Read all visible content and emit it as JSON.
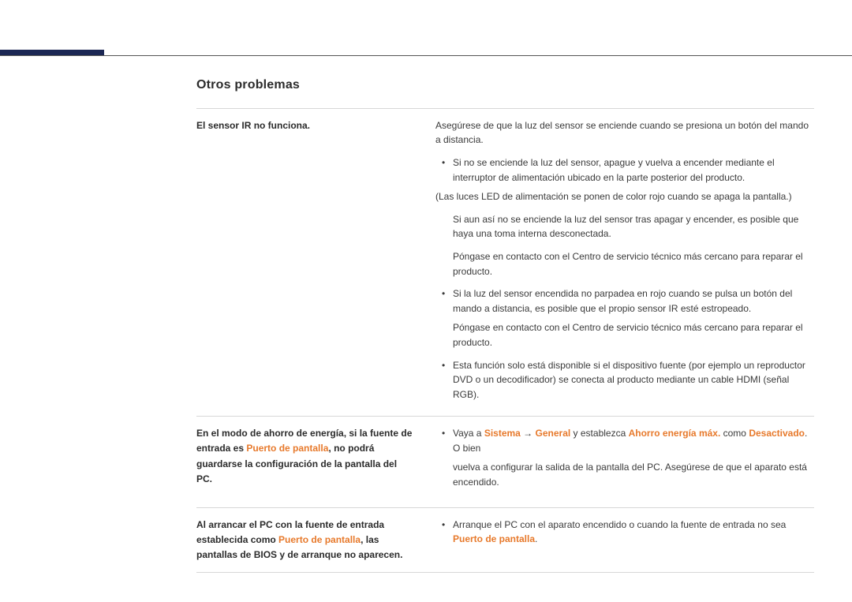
{
  "heading": "Otros problemas",
  "rows": [
    {
      "left_parts": [
        {
          "text": "El sensor IR no funciona.",
          "bold": true
        }
      ],
      "right_blocks": [
        {
          "type": "p",
          "parts": [
            {
              "text": "Asegúrese de que la luz del sensor se enciende cuando se presiona un botón del mando a distancia."
            }
          ]
        },
        {
          "type": "bullet",
          "parts": [
            {
              "text": "Si no se enciende la luz del sensor, apague y vuelva a encender mediante el interruptor de alimentación ubicado en la parte posterior del producto."
            }
          ]
        },
        {
          "type": "note",
          "parts": [
            {
              "text": "(Las luces LED de alimentación se ponen de color rojo cuando se apaga la pantalla.)"
            }
          ]
        },
        {
          "type": "plain",
          "parts": [
            {
              "text": "Si aun así no se enciende la luz del sensor tras apagar y encender, es posible que haya una toma interna desconectada."
            }
          ]
        },
        {
          "type": "plain",
          "parts": [
            {
              "text": "Póngase en contacto con el Centro de servicio técnico más cercano para reparar el producto."
            }
          ]
        },
        {
          "type": "bullet",
          "parts": [
            {
              "text": "Si la luz del sensor encendida no parpadea en rojo cuando se pulsa un botón del mando a distancia, es posible que el propio sensor IR esté estropeado."
            }
          ]
        },
        {
          "type": "plain",
          "parts": [
            {
              "text": "Póngase en contacto con el Centro de servicio técnico más cercano para reparar el producto."
            }
          ]
        },
        {
          "type": "bullet",
          "parts": [
            {
              "text": "Esta función solo está disponible si el dispositivo fuente (por ejemplo un reproductor DVD o un decodificador) se conecta al producto mediante un cable HDMI (señal RGB)."
            }
          ]
        }
      ]
    },
    {
      "left_parts": [
        {
          "text": "En el modo de ahorro de energía, si la fuente de entrada es ",
          "bold": true
        },
        {
          "text": "Puerto de pantalla",
          "bold_orange": true
        },
        {
          "text": ", no podrá guardarse la configuración de la pantalla del PC.",
          "bold": true
        }
      ],
      "right_blocks": [
        {
          "type": "bullet",
          "parts": [
            {
              "text": "Vaya a "
            },
            {
              "text": "Sistema",
              "bold_orange": true
            },
            {
              "text": " → "
            },
            {
              "text": "General",
              "bold_orange": true
            },
            {
              "text": " y establezca "
            },
            {
              "text": "Ahorro energía máx.",
              "bold_orange": true
            },
            {
              "text": " como "
            },
            {
              "text": "Desactivado",
              "bold_orange": true
            },
            {
              "text": ". O bien"
            }
          ]
        },
        {
          "type": "plain",
          "parts": [
            {
              "text": "vuelva a configurar la salida de la pantalla del PC. Asegúrese de que el aparato está encendido."
            }
          ]
        }
      ]
    },
    {
      "left_parts": [
        {
          "text": "Al arrancar el PC con la fuente de entrada establecida como ",
          "bold": true
        },
        {
          "text": "Puerto de pantalla",
          "bold_orange": true
        },
        {
          "text": ", las pantallas de BIOS y de arranque no aparecen.",
          "bold": true
        }
      ],
      "right_blocks": [
        {
          "type": "bullet",
          "parts": [
            {
              "text": "Arranque el PC con el aparato encendido o cuando la fuente de entrada no sea "
            },
            {
              "text": "Puerto de pantalla",
              "bold_orange": true
            },
            {
              "text": "."
            }
          ]
        }
      ]
    }
  ]
}
